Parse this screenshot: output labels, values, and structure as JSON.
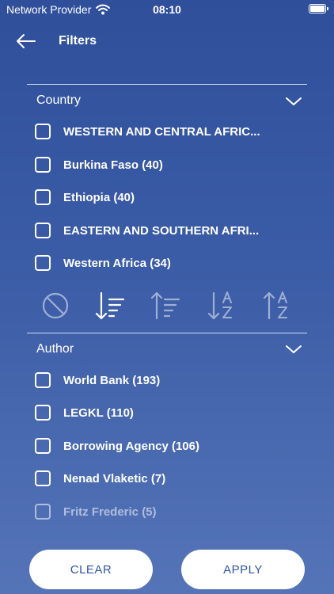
{
  "status": {
    "carrier": "Network Provider",
    "time": "08:10"
  },
  "header": {
    "title": "Filters"
  },
  "country": {
    "title": "Country",
    "items": [
      {
        "label": "WESTERN AND CENTRAL AFRIC..."
      },
      {
        "label": "Burkina Faso (40)"
      },
      {
        "label": "Ethiopia (40)"
      },
      {
        "label": "EASTERN AND SOUTHERN AFRI..."
      },
      {
        "label": "Western Africa (34)"
      }
    ]
  },
  "sort_icons": [
    "none-sort-icon",
    "sort-desc-icon",
    "sort-asc-icon",
    "sort-az-desc-icon",
    "sort-az-asc-icon"
  ],
  "author": {
    "title": "Author",
    "items": [
      {
        "label": "World Bank (193)"
      },
      {
        "label": "LEGKL (110)"
      },
      {
        "label": "Borrowing Agency (106)"
      },
      {
        "label": "Nenad Vlaketic (7)"
      },
      {
        "label": "Fritz Frederic (5)"
      }
    ]
  },
  "buttons": {
    "clear": "CLEAR",
    "apply": "APPLY"
  }
}
